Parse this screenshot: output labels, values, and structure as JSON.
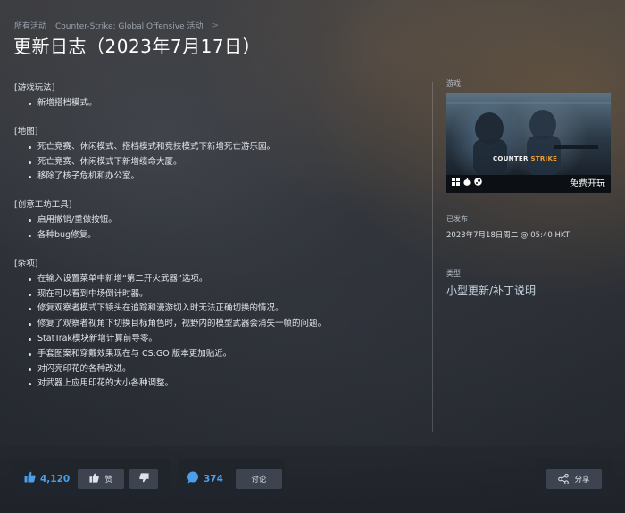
{
  "breadcrumb": {
    "items": [
      "所有活动",
      "Counter-Strike: Global Offensive 活动"
    ],
    "separator": ">"
  },
  "page_title": "更新日志（2023年7月17日）",
  "sections": [
    {
      "title": "[游戏玩法]",
      "items": [
        "新增搭档模式。"
      ]
    },
    {
      "title": "[地图]",
      "items": [
        "死亡竞赛、休闲模式、搭档模式和竞技模式下新增死亡游乐园。",
        "死亡竞赛、休闲模式下新增缆命大厦。",
        "移除了核子危机和办公室。"
      ]
    },
    {
      "title": "[创意工坊工具]",
      "items": [
        "启用撤销/重做按钮。",
        "各种bug修复。"
      ]
    },
    {
      "title": "[杂项]",
      "items": [
        "在输入设置菜单中新增“第二开火武器”选项。",
        "现在可以看到中场倒计时器。",
        "修复观察者模式下镜头在追踪和漫游切入时无法正确切换的情况。",
        "修复了观察者视角下切换目标角色时，视野内的模型武器会消失一帧的问题。",
        "StatTrak模块新增计算前导零。",
        "手套图案和穿戴效果现在与 CS:GO 版本更加贴近。",
        "对闪亮印花的各种改进。",
        "对武器上应用印花的大小各种调整。"
      ]
    }
  ],
  "sidebar": {
    "game_label": "游戏",
    "game_logo_text": {
      "part1": "COUNTER",
      "part2": "STRIKE"
    },
    "platforms": [
      "windows-icon",
      "apple-icon",
      "steam-icon"
    ],
    "free_play": "免费开玩",
    "published_label": "已发布",
    "published_date": "2023年7月18日周二 @ 05:40 HKT",
    "type_label": "类型",
    "type_value": "小型更新/补丁说明"
  },
  "footer": {
    "vote_count": "4,120",
    "like_label": "赞",
    "comment_count": "374",
    "discuss_label": "讨论",
    "share_label": "分享"
  },
  "colors": {
    "accent_blue": "#4c9eea",
    "title_white": "#ffffff",
    "panel_bg": "#21252c",
    "button_bg": "#3d4450"
  }
}
